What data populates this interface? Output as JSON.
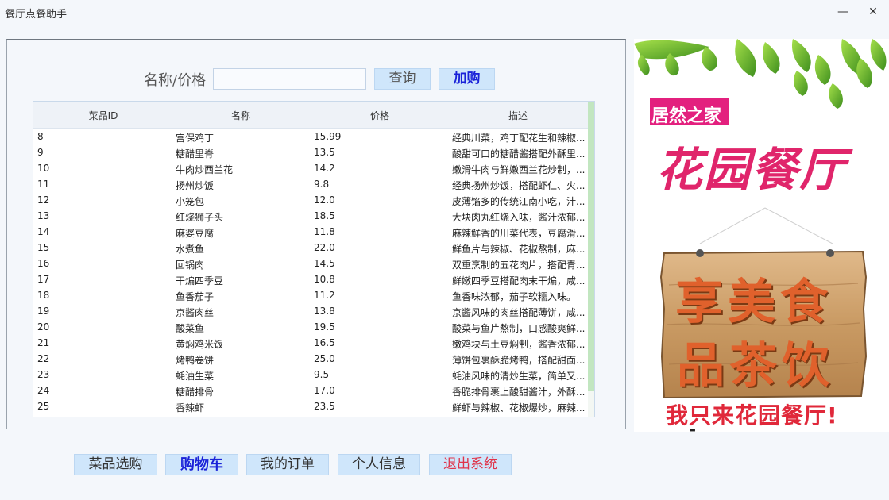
{
  "window": {
    "title": "餐厅点餐助手",
    "minimize": "—",
    "close": "✕"
  },
  "search": {
    "label": "名称/价格",
    "value": "",
    "query_button": "查询",
    "add_button": "加购"
  },
  "table": {
    "headers": [
      "菜品ID",
      "名称",
      "价格",
      "描述"
    ],
    "rows": [
      [
        "8",
        "宫保鸡丁",
        "15.99",
        "经典川菜，鸡丁配花生和辣椒..."
      ],
      [
        "9",
        "糖醋里脊",
        "13.5",
        "酸甜可口的糖醋酱搭配外酥里..."
      ],
      [
        "10",
        "牛肉炒西兰花",
        "14.2",
        "嫩滑牛肉与鲜嫩西兰花炒制，..."
      ],
      [
        "11",
        "扬州炒饭",
        "9.8",
        "经典扬州炒饭，搭配虾仁、火..."
      ],
      [
        "12",
        "小笼包",
        "12.0",
        "皮薄馅多的传统江南小吃，汁..."
      ],
      [
        "13",
        "红烧狮子头",
        "18.5",
        "大块肉丸红烧入味，酱汁浓郁..."
      ],
      [
        "14",
        "麻婆豆腐",
        "11.8",
        "麻辣鲜香的川菜代表，豆腐滑..."
      ],
      [
        "15",
        "水煮鱼",
        "22.0",
        "鲜鱼片与辣椒、花椒熬制，麻..."
      ],
      [
        "16",
        "回锅肉",
        "14.5",
        "双重烹制的五花肉片，搭配青..."
      ],
      [
        "17",
        "干煸四季豆",
        "10.8",
        "鲜嫩四季豆搭配肉末干煸，咸..."
      ],
      [
        "18",
        "鱼香茄子",
        "11.2",
        "鱼香味浓郁，茄子软糯入味。"
      ],
      [
        "19",
        "京酱肉丝",
        "13.8",
        "京酱风味的肉丝搭配薄饼，咸..."
      ],
      [
        "20",
        "酸菜鱼",
        "19.5",
        "酸菜与鱼片熬制，口感酸爽鲜..."
      ],
      [
        "21",
        "黄焖鸡米饭",
        "16.5",
        "嫩鸡块与土豆焖制，酱香浓郁..."
      ],
      [
        "22",
        "烤鸭卷饼",
        "25.0",
        "薄饼包裹酥脆烤鸭，搭配甜面..."
      ],
      [
        "23",
        "蚝油生菜",
        "9.5",
        "蚝油风味的清炒生菜，简单又..."
      ],
      [
        "24",
        "糖醋排骨",
        "17.0",
        "香脆排骨裹上酸甜酱汁，外酥..."
      ],
      [
        "25",
        "香辣虾",
        "23.5",
        "鲜虾与辣椒、花椒爆炒，麻辣..."
      ]
    ]
  },
  "ad": {
    "brand": "居然之家",
    "restaurant": "花园餐厅",
    "sign_line1": "享美食",
    "sign_line2": "品茶饮",
    "slogan": "我只来花园餐厅!"
  },
  "nav": {
    "menu": "菜品选购",
    "cart": "购物车",
    "orders": "我的订单",
    "profile": "个人信息",
    "logout": "退出系统"
  },
  "colors": {
    "button_bg": "#cfe6fb",
    "active_blue": "#1a22d8",
    "logout_red": "#e0344a",
    "brand_pink": "#e3207e",
    "restaurant_red": "#e0256b",
    "sign_text": "#e0612c",
    "scroll_green": "#c2e6c0"
  }
}
